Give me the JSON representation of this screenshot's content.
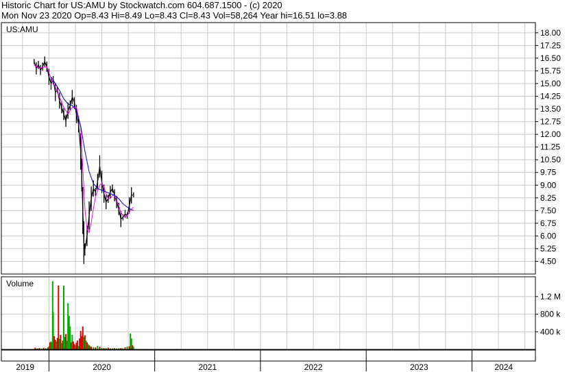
{
  "header": {
    "line1": "Historic Chart for US:AMU by Stockwatch.com 604.687.1500 - (c) 2020",
    "line2": "Mon Nov 23 2020  Op=8.43  Hi=8.49  Lo=8.43  Cl=8.43  Vol=58,264  Year hi=16.51  lo=3.88"
  },
  "chart_data": {
    "type": "line",
    "price_panel_label": "US:AMU",
    "volume_panel_label": "Volume",
    "price_ticks": [
      "18.00",
      "17.25",
      "16.50",
      "15.75",
      "15.00",
      "14.25",
      "13.50",
      "12.75",
      "12.00",
      "11.25",
      "10.50",
      "9.75",
      "9.00",
      "8.25",
      "7.50",
      "6.75",
      "6.00",
      "5.25",
      "4.50"
    ],
    "price_ylim": [
      3.75,
      18.6
    ],
    "volume_ticks": [
      "1.2 M",
      "800 k",
      "400 k"
    ],
    "volume_ylim": [
      0,
      1650000
    ],
    "year_labels": [
      "2019",
      "2020",
      "2021",
      "2022",
      "2023",
      "2024"
    ],
    "grid": true,
    "colors": {
      "grid": "#c8c8c8",
      "up_volume": "#00aa00",
      "down_volume": "#dd0000",
      "price_bar": "#000000",
      "ma_short": "#ff00ff",
      "ma_long": "#0000cc"
    },
    "series": [
      {
        "values": [
          [
            2019.86,
            16.3
          ],
          [
            2019.88,
            15.9
          ],
          [
            2019.9,
            16.1
          ],
          [
            2019.92,
            15.8
          ],
          [
            2019.94,
            16.0
          ],
          [
            2019.96,
            16.3
          ],
          [
            2019.98,
            16.0
          ],
          [
            2020.0,
            15.4
          ],
          [
            2020.02,
            15.0
          ],
          [
            2020.04,
            15.2
          ],
          [
            2020.06,
            14.5
          ],
          [
            2020.08,
            14.6
          ],
          [
            2020.1,
            14.0
          ],
          [
            2020.12,
            13.6
          ],
          [
            2020.14,
            13.2
          ],
          [
            2020.16,
            12.8
          ],
          [
            2020.18,
            13.4
          ],
          [
            2020.2,
            13.7
          ],
          [
            2020.22,
            14.2
          ],
          [
            2020.24,
            13.9
          ],
          [
            2020.26,
            13.2
          ],
          [
            2020.28,
            12.6
          ],
          [
            2020.3,
            11.0
          ],
          [
            2020.31,
            9.6
          ],
          [
            2020.32,
            7.5
          ],
          [
            2020.33,
            5.6
          ],
          [
            2020.34,
            5.2
          ],
          [
            2020.36,
            6.0
          ],
          [
            2020.38,
            7.2
          ],
          [
            2020.4,
            8.2
          ],
          [
            2020.42,
            8.8
          ],
          [
            2020.44,
            8.6
          ],
          [
            2020.46,
            9.2
          ],
          [
            2020.48,
            10.1
          ],
          [
            2020.5,
            9.2
          ],
          [
            2020.52,
            8.5
          ],
          [
            2020.54,
            8.0
          ],
          [
            2020.56,
            8.2
          ],
          [
            2020.58,
            8.6
          ],
          [
            2020.6,
            8.8
          ],
          [
            2020.62,
            8.4
          ],
          [
            2020.64,
            8.0
          ],
          [
            2020.66,
            7.6
          ],
          [
            2020.68,
            7.0
          ],
          [
            2020.7,
            7.1
          ],
          [
            2020.72,
            7.3
          ],
          [
            2020.74,
            7.2
          ],
          [
            2020.76,
            7.8
          ],
          [
            2020.78,
            8.4
          ],
          [
            2020.8,
            8.43
          ]
        ]
      },
      {
        "values": [
          [
            2019.86,
            16.1
          ],
          [
            2019.9,
            15.9
          ],
          [
            2019.94,
            15.95
          ],
          [
            2019.98,
            16.0
          ],
          [
            2020.02,
            15.3
          ],
          [
            2020.06,
            14.8
          ],
          [
            2020.1,
            14.2
          ],
          [
            2020.14,
            13.6
          ],
          [
            2020.18,
            13.2
          ],
          [
            2020.22,
            13.6
          ],
          [
            2020.26,
            13.6
          ],
          [
            2020.3,
            12.4
          ],
          [
            2020.32,
            10.0
          ],
          [
            2020.34,
            7.6
          ],
          [
            2020.36,
            6.4
          ],
          [
            2020.38,
            6.2
          ],
          [
            2020.4,
            6.8
          ],
          [
            2020.42,
            7.6
          ],
          [
            2020.44,
            8.3
          ],
          [
            2020.46,
            8.7
          ],
          [
            2020.48,
            9.0
          ],
          [
            2020.5,
            9.1
          ],
          [
            2020.52,
            8.9
          ],
          [
            2020.54,
            8.5
          ],
          [
            2020.56,
            8.2
          ],
          [
            2020.58,
            8.2
          ],
          [
            2020.6,
            8.4
          ],
          [
            2020.62,
            8.4
          ],
          [
            2020.64,
            8.1
          ],
          [
            2020.66,
            7.8
          ],
          [
            2020.68,
            7.4
          ],
          [
            2020.7,
            7.2
          ],
          [
            2020.72,
            7.1
          ],
          [
            2020.74,
            7.2
          ],
          [
            2020.76,
            7.4
          ],
          [
            2020.78,
            7.6
          ],
          [
            2020.8,
            7.7
          ]
        ]
      },
      {
        "values": [
          [
            2020.02,
            15.4
          ],
          [
            2020.06,
            15.0
          ],
          [
            2020.1,
            14.6
          ],
          [
            2020.14,
            14.1
          ],
          [
            2020.18,
            13.8
          ],
          [
            2020.22,
            13.7
          ],
          [
            2020.26,
            13.4
          ],
          [
            2020.3,
            12.5
          ],
          [
            2020.34,
            11.0
          ],
          [
            2020.38,
            9.8
          ],
          [
            2020.42,
            9.1
          ],
          [
            2020.46,
            8.8
          ],
          [
            2020.5,
            8.7
          ],
          [
            2020.54,
            8.6
          ],
          [
            2020.58,
            8.5
          ],
          [
            2020.62,
            8.4
          ],
          [
            2020.66,
            8.2
          ],
          [
            2020.7,
            7.9
          ],
          [
            2020.74,
            7.7
          ],
          [
            2020.78,
            7.55
          ],
          [
            2020.8,
            7.5
          ]
        ]
      }
    ],
    "volume": [
      {
        "x": 2019.87,
        "v": 40000,
        "up": false
      },
      {
        "x": 2019.89,
        "v": 25000,
        "up": true
      },
      {
        "x": 2019.91,
        "v": 30000,
        "up": false
      },
      {
        "x": 2019.93,
        "v": 20000,
        "up": true
      },
      {
        "x": 2019.95,
        "v": 35000,
        "up": false
      },
      {
        "x": 2019.97,
        "v": 28000,
        "up": true
      },
      {
        "x": 2019.99,
        "v": 45000,
        "up": false
      },
      {
        "x": 2020.0,
        "v": 70000,
        "up": true
      },
      {
        "x": 2020.01,
        "v": 160000,
        "up": false
      },
      {
        "x": 2020.02,
        "v": 180000,
        "up": true
      },
      {
        "x": 2020.03,
        "v": 150000,
        "up": false
      },
      {
        "x": 2020.035,
        "v": 1550000,
        "up": true
      },
      {
        "x": 2020.04,
        "v": 850000,
        "up": true
      },
      {
        "x": 2020.05,
        "v": 300000,
        "up": false
      },
      {
        "x": 2020.06,
        "v": 220000,
        "up": false
      },
      {
        "x": 2020.07,
        "v": 180000,
        "up": true
      },
      {
        "x": 2020.08,
        "v": 260000,
        "up": false
      },
      {
        "x": 2020.09,
        "v": 1450000,
        "up": false
      },
      {
        "x": 2020.1,
        "v": 240000,
        "up": true
      },
      {
        "x": 2020.11,
        "v": 330000,
        "up": false
      },
      {
        "x": 2020.12,
        "v": 140000,
        "up": true
      },
      {
        "x": 2020.13,
        "v": 200000,
        "up": false
      },
      {
        "x": 2020.14,
        "v": 1450000,
        "up": true
      },
      {
        "x": 2020.15,
        "v": 280000,
        "up": true
      },
      {
        "x": 2020.16,
        "v": 350000,
        "up": false
      },
      {
        "x": 2020.17,
        "v": 200000,
        "up": true
      },
      {
        "x": 2020.18,
        "v": 1050000,
        "up": true
      },
      {
        "x": 2020.19,
        "v": 760000,
        "up": true
      },
      {
        "x": 2020.2,
        "v": 520000,
        "up": true
      },
      {
        "x": 2020.21,
        "v": 160000,
        "up": false
      },
      {
        "x": 2020.22,
        "v": 330000,
        "up": true
      },
      {
        "x": 2020.23,
        "v": 180000,
        "up": false
      },
      {
        "x": 2020.24,
        "v": 120000,
        "up": false
      },
      {
        "x": 2020.25,
        "v": 90000,
        "up": true
      },
      {
        "x": 2020.26,
        "v": 150000,
        "up": false
      },
      {
        "x": 2020.27,
        "v": 200000,
        "up": false
      },
      {
        "x": 2020.28,
        "v": 80000,
        "up": true
      },
      {
        "x": 2020.29,
        "v": 250000,
        "up": false
      },
      {
        "x": 2020.3,
        "v": 420000,
        "up": false
      },
      {
        "x": 2020.31,
        "v": 300000,
        "up": false
      },
      {
        "x": 2020.32,
        "v": 520000,
        "up": false
      },
      {
        "x": 2020.33,
        "v": 280000,
        "up": true
      },
      {
        "x": 2020.34,
        "v": 320000,
        "up": false
      },
      {
        "x": 2020.35,
        "v": 200000,
        "up": true
      },
      {
        "x": 2020.36,
        "v": 160000,
        "up": false
      },
      {
        "x": 2020.37,
        "v": 120000,
        "up": true
      },
      {
        "x": 2020.38,
        "v": 90000,
        "up": false
      },
      {
        "x": 2020.39,
        "v": 70000,
        "up": true
      },
      {
        "x": 2020.4,
        "v": 60000,
        "up": false
      },
      {
        "x": 2020.42,
        "v": 50000,
        "up": true
      },
      {
        "x": 2020.44,
        "v": 45000,
        "up": false
      },
      {
        "x": 2020.46,
        "v": 80000,
        "up": true
      },
      {
        "x": 2020.48,
        "v": 60000,
        "up": false
      },
      {
        "x": 2020.5,
        "v": 35000,
        "up": true
      },
      {
        "x": 2020.52,
        "v": 30000,
        "up": false
      },
      {
        "x": 2020.54,
        "v": 28000,
        "up": true
      },
      {
        "x": 2020.56,
        "v": 40000,
        "up": false
      },
      {
        "x": 2020.58,
        "v": 25000,
        "up": true
      },
      {
        "x": 2020.6,
        "v": 22000,
        "up": false
      },
      {
        "x": 2020.62,
        "v": 30000,
        "up": true
      },
      {
        "x": 2020.64,
        "v": 20000,
        "up": false
      },
      {
        "x": 2020.66,
        "v": 26000,
        "up": true
      },
      {
        "x": 2020.68,
        "v": 30000,
        "up": false
      },
      {
        "x": 2020.7,
        "v": 24000,
        "up": true
      },
      {
        "x": 2020.72,
        "v": 45000,
        "up": false
      },
      {
        "x": 2020.74,
        "v": 60000,
        "up": true
      },
      {
        "x": 2020.76,
        "v": 70000,
        "up": false
      },
      {
        "x": 2020.77,
        "v": 360000,
        "up": true
      },
      {
        "x": 2020.78,
        "v": 250000,
        "up": true
      },
      {
        "x": 2020.79,
        "v": 90000,
        "up": false
      },
      {
        "x": 2020.8,
        "v": 58264,
        "up": true
      }
    ]
  }
}
